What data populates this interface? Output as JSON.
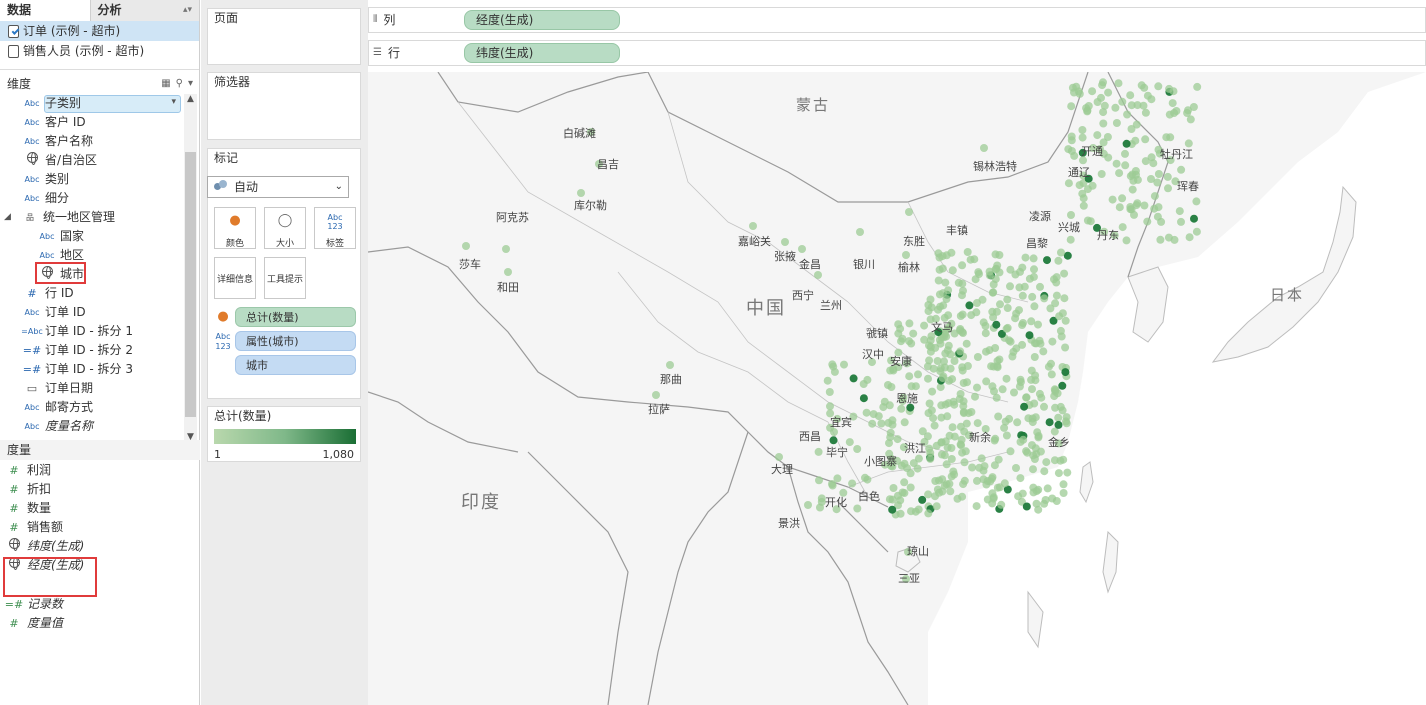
{
  "tabs": {
    "data": "数据",
    "analysis": "分析"
  },
  "datasources": [
    {
      "label": "订单 (示例 - 超市)",
      "selected": true
    },
    {
      "label": "销售人员 (示例 - 超市)",
      "selected": false
    }
  ],
  "dimensions": {
    "header": "维度",
    "items": [
      {
        "icon": "Abc",
        "label": "子类别"
      },
      {
        "icon": "Abc",
        "label": "客户 ID"
      },
      {
        "icon": "Abc",
        "label": "客户名称"
      },
      {
        "icon": "globe",
        "label": "省/自治区"
      },
      {
        "icon": "Abc",
        "label": "类别"
      },
      {
        "icon": "Abc",
        "label": "细分"
      },
      {
        "icon": "hierarchy",
        "label": "统一地区管理"
      },
      {
        "icon": "Abc",
        "label": "国家"
      },
      {
        "icon": "Abc",
        "label": "地区"
      },
      {
        "icon": "globe",
        "label": "城市"
      },
      {
        "icon": "#",
        "label": "行 ID"
      },
      {
        "icon": "Abc",
        "label": "订单 ID"
      },
      {
        "icon": "=Abc",
        "label": "订单 ID - 拆分 1"
      },
      {
        "icon": "=#",
        "label": "订单 ID - 拆分 2"
      },
      {
        "icon": "=#",
        "label": "订单 ID - 拆分 3"
      },
      {
        "icon": "date",
        "label": "订单日期"
      },
      {
        "icon": "Abc",
        "label": "邮寄方式"
      },
      {
        "icon": "Abc",
        "label": "度量名称"
      }
    ]
  },
  "measures": {
    "header": "度量",
    "items": [
      {
        "icon": "#",
        "label": "利润"
      },
      {
        "icon": "#",
        "label": "折扣"
      },
      {
        "icon": "#",
        "label": "数量"
      },
      {
        "icon": "#",
        "label": "销售额"
      },
      {
        "icon": "globe",
        "label": "纬度(生成)"
      },
      {
        "icon": "globe",
        "label": "经度(生成)"
      },
      {
        "icon": "=#",
        "label": "记录数"
      },
      {
        "icon": "#",
        "label": "度量值"
      }
    ]
  },
  "cards": {
    "pages": "页面",
    "filters": "筛选器",
    "marks": "标记",
    "mark_type": "自动",
    "buttons": {
      "color": "颜色",
      "size": "大小",
      "label": "标签",
      "detail": "详细信息",
      "tooltip": "工具提示"
    },
    "pills": [
      "总计(数量)",
      "属性(城市)",
      "城市"
    ],
    "legend_title": "总计(数量)",
    "legend_min": "1",
    "legend_max": "1,080"
  },
  "shelves": {
    "columns_label": "列",
    "columns_pill": "经度(生成)",
    "rows_label": "行",
    "rows_pill": "纬度(生成)"
  },
  "map": {
    "countries": [
      "蒙古",
      "中国",
      "印度",
      "日本"
    ],
    "cities": [
      "白碱滩",
      "昌吉",
      "库尔勒",
      "阿克苏",
      "莎车",
      "和田",
      "嘉峪关",
      "张掖",
      "金昌",
      "银川",
      "东胜",
      "榆林",
      "锡林浩特",
      "开通",
      "通辽",
      "牡丹江",
      "珲春",
      "凌源",
      "兴城",
      "丹东",
      "丰镇",
      "昌黎",
      "西宁",
      "兰州",
      "那曲",
      "拉萨",
      "虢镇",
      "汉中",
      "安康",
      "文马",
      "恩施",
      "新余",
      "金乡",
      "西昌",
      "宜宾",
      "毕宁",
      "小图寨",
      "洪江",
      "大理",
      "开化",
      "白色",
      "景洪",
      "琼山",
      "三亚"
    ],
    "colors": {
      "land": "#f5f5f5",
      "water": "#ffffff",
      "border": "#9a9a9a",
      "mark_light": "#a9d2a3",
      "mark_dark": "#1a6e34"
    }
  }
}
